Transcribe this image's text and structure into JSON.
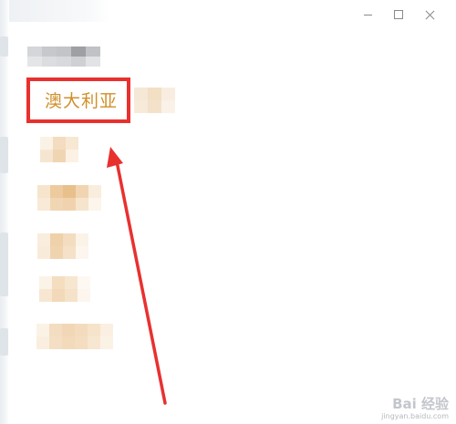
{
  "window": {
    "minimize_icon": "minimize-icon",
    "maximize_icon": "maximize-icon",
    "close_icon": "close-icon"
  },
  "list": {
    "highlighted_item": "澳大利亚"
  },
  "annotation": {
    "box_color": "#e8312f",
    "arrow_color": "#e8312f",
    "highlight_text_color": "#d18f2a"
  },
  "watermark": {
    "brand": "Bai 经验",
    "url": "jingyan.baidu.com"
  }
}
